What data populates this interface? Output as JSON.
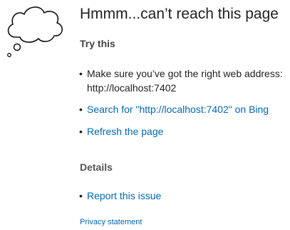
{
  "error_page": {
    "title": "Hmmm...can’t reach this page",
    "try_heading": "Try this",
    "suggestions": [
      {
        "text": "Make sure you’ve got the right web address: http://localhost:7402",
        "is_link": false
      },
      {
        "text": "Search for \"http://localhost:7402\" on Bing",
        "is_link": true
      },
      {
        "text": "Refresh the page",
        "is_link": true
      }
    ],
    "details_heading": "Details",
    "details_items": [
      {
        "text": "Report this issue",
        "is_link": true
      }
    ],
    "privacy_label": "Privacy statement",
    "colors": {
      "link": "#0067b8",
      "text": "#1f1f1f"
    },
    "icon": "thought-cloud-icon"
  }
}
